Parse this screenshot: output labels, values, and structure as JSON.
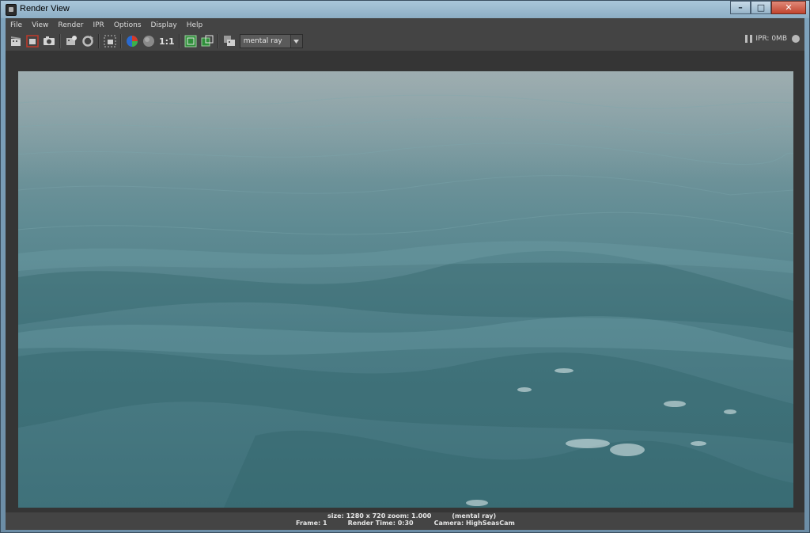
{
  "window": {
    "title": "Render View"
  },
  "menu": [
    "File",
    "View",
    "Render",
    "IPR",
    "Options",
    "Display",
    "Help"
  ],
  "toolbar": {
    "ratio_label": "1:1",
    "renderer": "mental ray",
    "ipr_status": "IPR: 0MB"
  },
  "icons": [
    "clapper-icon",
    "redo-render-icon",
    "snapshot-icon",
    "ipr-render-icon",
    "refresh-icon",
    "region-render-icon",
    "color-channels-icon",
    "alpha-channel-icon",
    "keep-image-icon",
    "remove-image-icon",
    "render-settings-icon"
  ],
  "status": {
    "size": "size: 1280 x 720 zoom: 1.000",
    "renderer": "(mental ray)",
    "frame": "Frame: 1",
    "render_time": "Render Time: 0:30",
    "camera": "Camera: HighSeasCam"
  },
  "colors": {
    "water_deep": "#3f717a",
    "water_far": "#8fa2a6",
    "panel": "#444444"
  }
}
